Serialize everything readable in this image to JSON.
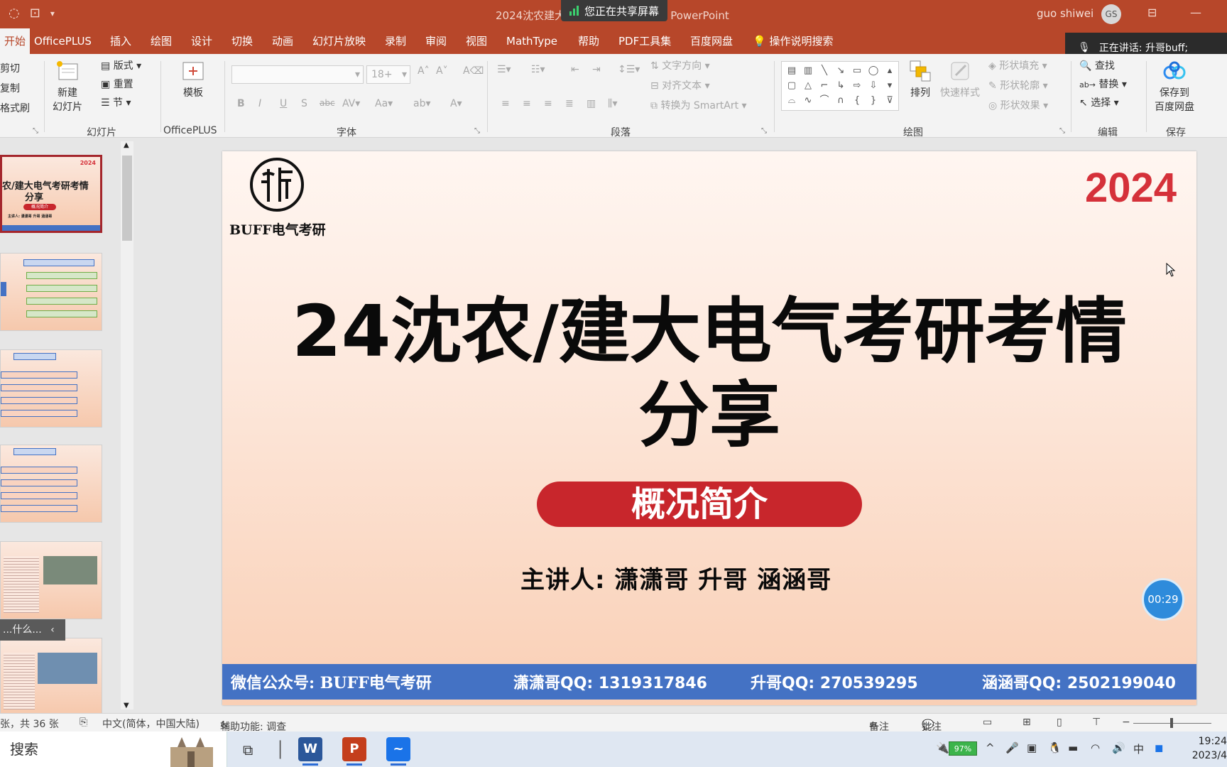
{
  "window": {
    "title": "2024沈农建大",
    "app_name": "PowerPoint",
    "sharing_label": "您正在共享屏幕",
    "user_name": "guo shiwei",
    "user_initials": "GS",
    "speaking": "正在讲话: 升哥buff;"
  },
  "menu": {
    "tabs": [
      "开始",
      "OfficePLUS",
      "插入",
      "绘图",
      "设计",
      "切换",
      "动画",
      "幻灯片放映",
      "录制",
      "审阅",
      "视图",
      "MathType",
      "帮助",
      "PDF工具集",
      "百度网盘"
    ],
    "tell_me": "操作说明搜索"
  },
  "ribbon": {
    "clipboard": {
      "cut": "剪切",
      "copy": "复制",
      "format_painter": "格式刷"
    },
    "slides": {
      "new_slide": "新建",
      "new_slide_2": "幻灯片",
      "layout": "版式",
      "reset": "重置",
      "section": "节",
      "label": "幻灯片"
    },
    "officeplus": {
      "template": "模板",
      "label": "OfficePLUS"
    },
    "font": {
      "size": "18+",
      "label": "字体"
    },
    "paragraph": {
      "text_direction": "文字方向",
      "align_text": "对齐文本",
      "smartart": "转换为 SmartArt",
      "label": "段落"
    },
    "drawing": {
      "arrange": "排列",
      "quick_styles": "快速样式",
      "shape_fill": "形状填充",
      "shape_outline": "形状轮廓",
      "shape_effects": "形状效果",
      "label": "绘图"
    },
    "editing": {
      "find": "查找",
      "replace": "替换",
      "select": "选择",
      "label": "编辑"
    },
    "save": {
      "save_to": "保存到",
      "baidu": "百度网盘",
      "label": "保存"
    }
  },
  "thumbnails": {
    "tip": "...什么...",
    "thumb1_year": "2024",
    "thumb1_title": "农/建大电气考研考情",
    "thumb1_title2": "分享",
    "thumb1_pill": "概况简介",
    "thumb1_speaker": "主讲人: 潇潇哥  升哥  涵涵哥"
  },
  "slide": {
    "brand": "BUFF电气考研",
    "year": "2024",
    "title_line1": "24沈农/建大电气考研考情",
    "title_line2": "分享",
    "subtitle": "概况简介",
    "speakers": "主讲人: 潇潇哥   升哥   涵涵哥",
    "footer": {
      "wechat": "微信公众号: BUFF电气考研",
      "xiao": "潇潇哥QQ: 1319317846",
      "sheng": "升哥QQ: 270539295",
      "han": "涵涵哥QQ: 2502199040"
    }
  },
  "timer": "00:29",
  "status": {
    "slide_count": "张，共 36 张",
    "language": "中文(简体，中国大陆)",
    "accessibility": "辅助功能: 调查",
    "notes": "备注",
    "comments": "批注"
  },
  "taskbar": {
    "search": "搜索",
    "battery": "97%",
    "ime": "中",
    "time": "19:24",
    "date": "2023/4"
  },
  "colors": {
    "ppt_red": "#b7472a",
    "year_red": "#d5313a",
    "pill_red": "#c8262c",
    "footer_blue": "#4472c4"
  }
}
